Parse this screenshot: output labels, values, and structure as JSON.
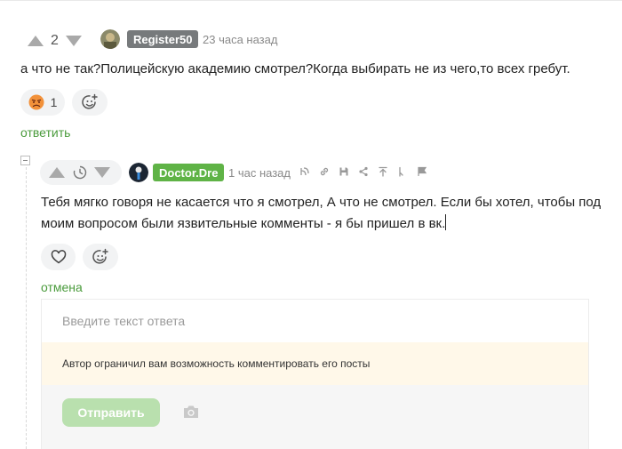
{
  "comment1": {
    "rating": "2",
    "username": "Register50",
    "time": "23 часа назад",
    "text": "а что не так?Полицейскую академию смотрел?Когда выбирать не из чего,то всех гребут.",
    "reaction_count": "1",
    "reply_label": "ответить"
  },
  "comment2": {
    "username": "Doctor.Dre",
    "time": "1 час назад",
    "text_line1": "Тебя мягко говоря не касается что я смотрел, А что не смотрел. Если бы хотел, чтобы под",
    "text_line2": "моим вопросом были язвительные комменты - я бы пришел в вк.",
    "cancel_label": "отмена"
  },
  "reply_form": {
    "placeholder": "Введите текст ответа",
    "notice": "Автор ограничил вам возможность комментировать его посты",
    "send_label": "Отправить"
  },
  "colors": {
    "accent_green": "#4a9b3c",
    "badge_green": "#5fb346",
    "badge_grey": "#777a7c",
    "notice_bg": "#fff8e9",
    "send_disabled": "#b9e0ae"
  },
  "icons": {
    "upvote": "triangle-up",
    "downvote": "triangle-down",
    "timer": "clock-icon",
    "reaction": "sad-face-emoji",
    "add_reaction": "smiley-plus-icon",
    "like": "heart-icon",
    "camera": "camera-icon"
  }
}
